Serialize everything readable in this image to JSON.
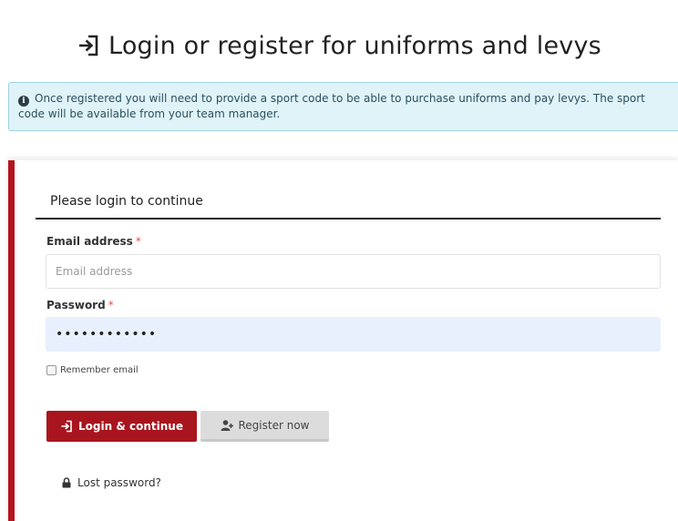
{
  "page": {
    "title": "Login or register for uniforms and levys",
    "title_icon": "sign-in-icon"
  },
  "alert": {
    "icon": "info-circle-icon",
    "text": "Once registered you will need to provide a sport code to be able to purchase uniforms and pay levys. The sport code will be available from your team manager."
  },
  "login_panel": {
    "heading": "Please login to continue",
    "email": {
      "label": "Email address",
      "required_marker": "*",
      "placeholder": "Email address",
      "value": ""
    },
    "password": {
      "label": "Password",
      "required_marker": "*",
      "value": "••••••••••••"
    },
    "remember": {
      "label": "Remember email",
      "checked": false
    },
    "login_button": {
      "label": "Login & continue",
      "icon": "sign-in-icon"
    },
    "register_button": {
      "label": "Register now",
      "icon": "user-plus-icon"
    },
    "lost_password": {
      "label": "Lost password?",
      "icon": "lock-icon"
    }
  },
  "colors": {
    "accent_red": "#a8151e",
    "panel_border_red": "#b5141e",
    "alert_background": "#dff3f8",
    "alert_border": "#9fd3e0",
    "password_autofill_background": "#e8f0fe"
  }
}
